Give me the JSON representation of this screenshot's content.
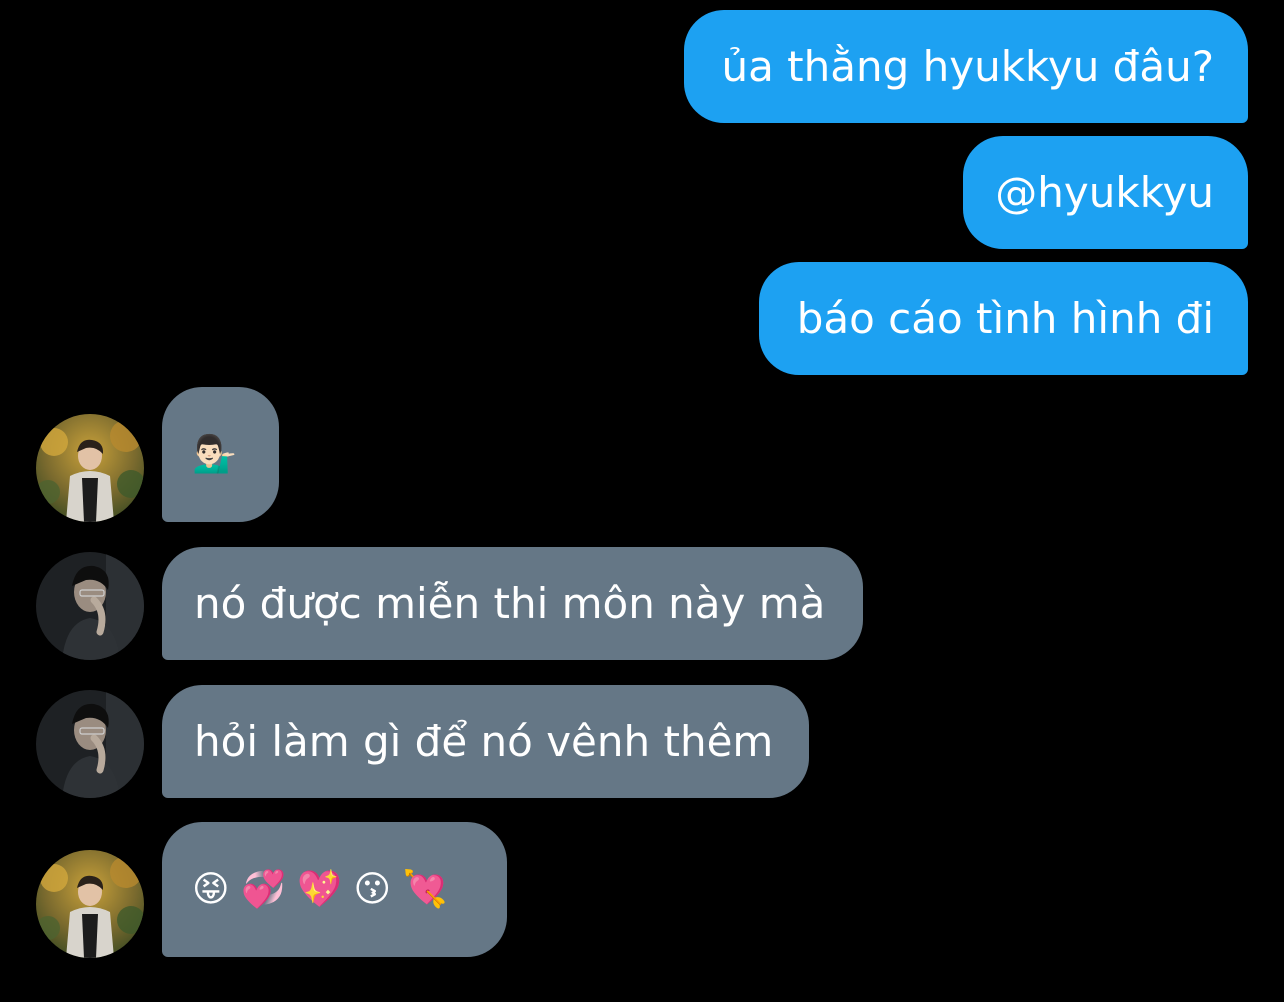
{
  "messages": {
    "sent": [
      {
        "text": "ủa thằng hyukkyu đâu?"
      },
      {
        "text": "@hyukkyu"
      },
      {
        "text": "báo cáo tình hình đi"
      }
    ],
    "received": [
      {
        "text": "💁🏻‍♂️"
      },
      {
        "text": "nó được miễn thi môn này mà"
      },
      {
        "text": "hỏi làm gì để nó vênh thêm"
      },
      {
        "text": "😝 💞 💖 😗 💘"
      }
    ]
  },
  "colors": {
    "background": "#000000",
    "sent_bubble": "#1da1f2",
    "received_bubble": "#657786",
    "text": "#ffffff"
  },
  "avatars": [
    {
      "icon": "avatar-photo-autumn-trees"
    },
    {
      "icon": "avatar-photo-dark-portrait"
    },
    {
      "icon": "avatar-photo-dark-portrait"
    },
    {
      "icon": "avatar-photo-autumn-trees"
    }
  ]
}
